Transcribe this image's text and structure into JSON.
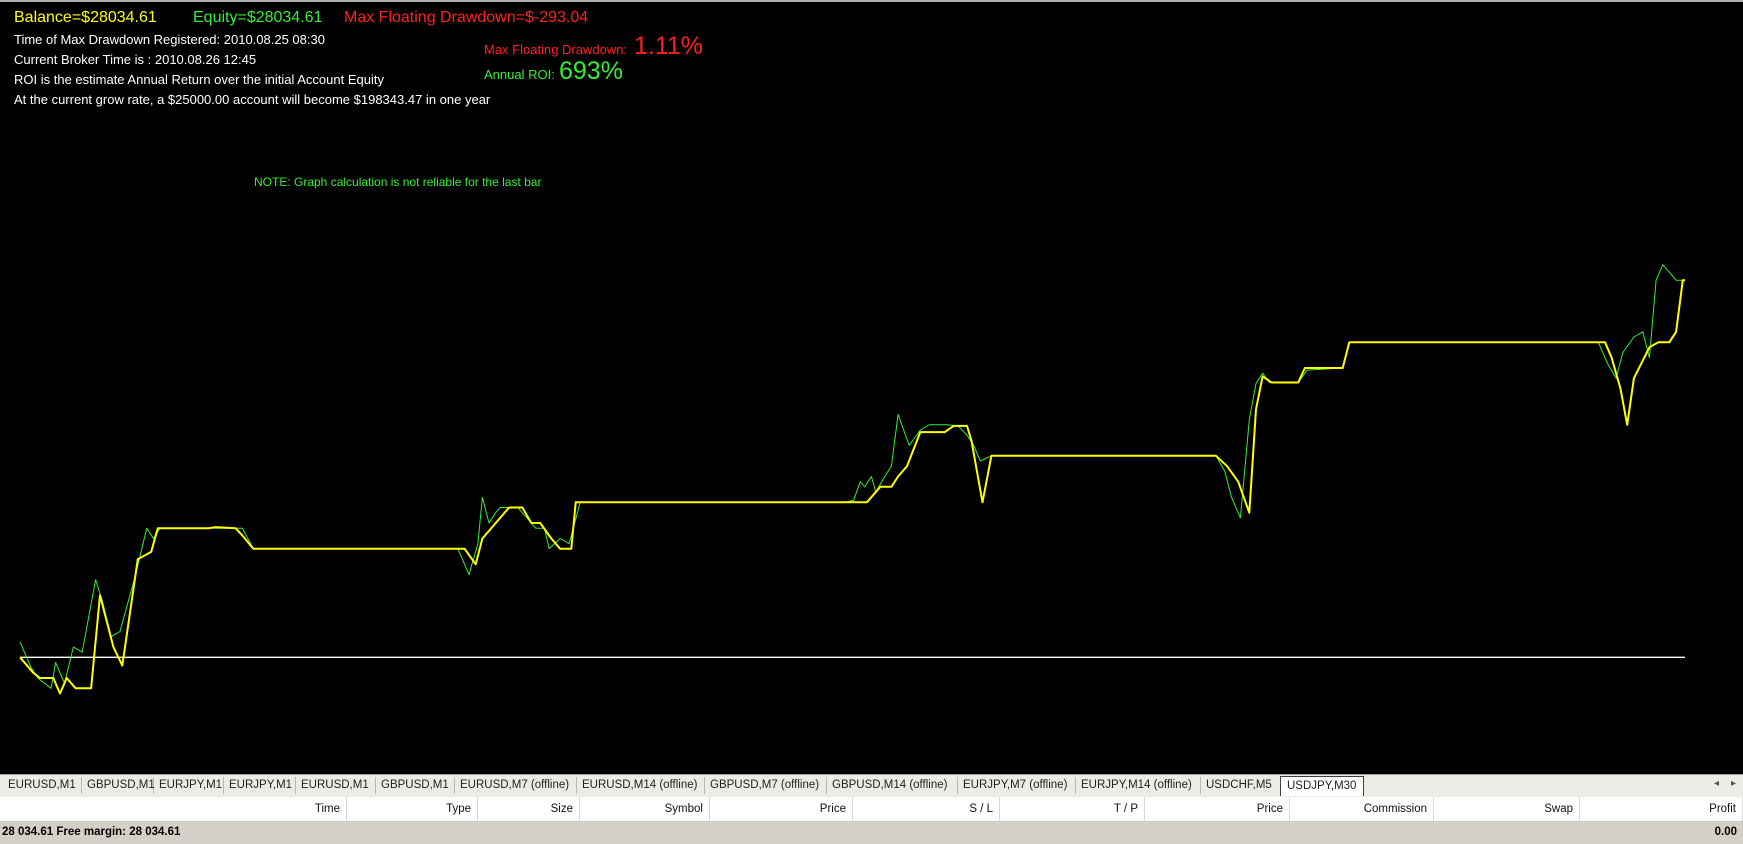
{
  "info": {
    "balance": "Balance=$28034.61",
    "equity": "Equity=$28034.61",
    "max_floating_drawdown": "Max Floating Drawdown=$-293.04",
    "time_max_drawdown": "Time of Max Drawdown Registered: 2010.08.25 08:30",
    "broker_time": "Current Broker Time is : 2010.08.26 12:45",
    "roi_note": "ROI is the estimate Annual Return over the initial Account Equity",
    "grow_rate": "At the current grow rate,  a $25000.00 account will become $198343.47 in one year",
    "dd_pct_label": "Max Floating Drawdown:",
    "dd_pct_value": "1.11%",
    "roi_label": "Annual ROI:",
    "roi_value": "693%",
    "graph_note": "NOTE: Graph calculation is not reliable for the last bar"
  },
  "colors": {
    "background": "#000000",
    "balance_yellow": "#ffff00",
    "equity_green": "#33ee33",
    "drawdown_red": "#ff2020",
    "baseline_white": "#ffffff"
  },
  "chart_data": {
    "type": "line",
    "title": "",
    "xlabel": "",
    "ylabel": "",
    "baseline": 25000,
    "ylim": [
      24200,
      30200
    ],
    "series": [
      {
        "color": "#ffff00",
        "points": [
          [
            0,
            25000
          ],
          [
            12,
            24850
          ],
          [
            18,
            24800
          ],
          [
            30,
            24800
          ],
          [
            36,
            24650
          ],
          [
            42,
            24800
          ],
          [
            50,
            24700
          ],
          [
            64,
            24700
          ],
          [
            72,
            25600
          ],
          [
            84,
            25100
          ],
          [
            92,
            24920
          ],
          [
            106,
            25950
          ],
          [
            118,
            26020
          ],
          [
            124,
            26250
          ],
          [
            170,
            26250
          ],
          [
            176,
            26260
          ],
          [
            194,
            26250
          ],
          [
            200,
            26180
          ],
          [
            210,
            26050
          ],
          [
            400,
            26050
          ],
          [
            410,
            25900
          ],
          [
            416,
            26150
          ],
          [
            440,
            26450
          ],
          [
            452,
            26450
          ],
          [
            460,
            26300
          ],
          [
            468,
            26300
          ],
          [
            478,
            26150
          ],
          [
            486,
            26050
          ],
          [
            496,
            26050
          ],
          [
            500,
            26500
          ],
          [
            762,
            26500
          ],
          [
            774,
            26650
          ],
          [
            784,
            26650
          ],
          [
            790,
            26750
          ],
          [
            798,
            26850
          ],
          [
            810,
            27180
          ],
          [
            832,
            27180
          ],
          [
            840,
            27240
          ],
          [
            852,
            27240
          ],
          [
            856,
            27100
          ],
          [
            866,
            26500
          ],
          [
            874,
            26950
          ],
          [
            1076,
            26950
          ],
          [
            1086,
            26850
          ],
          [
            1096,
            26700
          ],
          [
            1106,
            26400
          ],
          [
            1112,
            27400
          ],
          [
            1118,
            27720
          ],
          [
            1126,
            27660
          ],
          [
            1150,
            27660
          ],
          [
            1156,
            27800
          ],
          [
            1190,
            27800
          ],
          [
            1196,
            28050
          ],
          [
            1426,
            28050
          ],
          [
            1432,
            27900
          ],
          [
            1440,
            27600
          ],
          [
            1446,
            27250
          ],
          [
            1452,
            27700
          ],
          [
            1466,
            28000
          ],
          [
            1474,
            28050
          ],
          [
            1484,
            28050
          ],
          [
            1490,
            28150
          ],
          [
            1496,
            28650
          ],
          [
            1498,
            28650
          ]
        ]
      },
      {
        "color": "#33ee33",
        "points": [
          [
            0,
            25150
          ],
          [
            10,
            24900
          ],
          [
            16,
            24800
          ],
          [
            28,
            24700
          ],
          [
            32,
            24950
          ],
          [
            40,
            24750
          ],
          [
            48,
            25100
          ],
          [
            56,
            25050
          ],
          [
            68,
            25750
          ],
          [
            74,
            25550
          ],
          [
            82,
            25200
          ],
          [
            90,
            25250
          ],
          [
            104,
            25800
          ],
          [
            114,
            26250
          ],
          [
            120,
            26150
          ],
          [
            126,
            26250
          ],
          [
            170,
            26250
          ],
          [
            200,
            26250
          ],
          [
            210,
            26050
          ],
          [
            394,
            26050
          ],
          [
            400,
            25900
          ],
          [
            404,
            25800
          ],
          [
            412,
            26100
          ],
          [
            416,
            26550
          ],
          [
            422,
            26300
          ],
          [
            428,
            26400
          ],
          [
            432,
            26450
          ],
          [
            448,
            26450
          ],
          [
            456,
            26350
          ],
          [
            464,
            26250
          ],
          [
            472,
            26250
          ],
          [
            476,
            26050
          ],
          [
            486,
            26150
          ],
          [
            494,
            26100
          ],
          [
            504,
            26500
          ],
          [
            742,
            26500
          ],
          [
            750,
            26520
          ],
          [
            756,
            26700
          ],
          [
            760,
            26650
          ],
          [
            766,
            26750
          ],
          [
            770,
            26600
          ],
          [
            778,
            26750
          ],
          [
            784,
            26850
          ],
          [
            790,
            27350
          ],
          [
            800,
            27050
          ],
          [
            810,
            27200
          ],
          [
            818,
            27250
          ],
          [
            826,
            27250
          ],
          [
            834,
            27250
          ],
          [
            844,
            27240
          ],
          [
            852,
            27150
          ],
          [
            858,
            27050
          ],
          [
            864,
            26900
          ],
          [
            874,
            26950
          ],
          [
            1076,
            26950
          ],
          [
            1084,
            26800
          ],
          [
            1090,
            26550
          ],
          [
            1098,
            26350
          ],
          [
            1106,
            27300
          ],
          [
            1112,
            27650
          ],
          [
            1118,
            27750
          ],
          [
            1124,
            27660
          ],
          [
            1150,
            27660
          ],
          [
            1158,
            27780
          ],
          [
            1190,
            27800
          ],
          [
            1196,
            28050
          ],
          [
            1420,
            28050
          ],
          [
            1428,
            27850
          ],
          [
            1436,
            27700
          ],
          [
            1442,
            27950
          ],
          [
            1452,
            28100
          ],
          [
            1460,
            28150
          ],
          [
            1466,
            27900
          ],
          [
            1472,
            28650
          ],
          [
            1478,
            28800
          ],
          [
            1490,
            28650
          ],
          [
            1498,
            28650
          ]
        ]
      },
      {
        "color": "#ffffff",
        "points": [
          [
            0,
            25000
          ],
          [
            1498,
            25000
          ]
        ]
      }
    ]
  },
  "tabs": [
    {
      "label": "EURUSD,M1",
      "active": false
    },
    {
      "label": "GBPUSD,M1",
      "active": false
    },
    {
      "label": "EURJPY,M1",
      "active": false
    },
    {
      "label": "EURJPY,M1",
      "active": false
    },
    {
      "label": "EURUSD,M1",
      "active": false
    },
    {
      "label": "GBPUSD,M1",
      "active": false
    },
    {
      "label": "EURUSD,M7 (offline)",
      "active": false
    },
    {
      "label": "EURUSD,M14 (offline)",
      "active": false
    },
    {
      "label": "GBPUSD,M7 (offline)",
      "active": false
    },
    {
      "label": "GBPUSD,M14 (offline)",
      "active": false
    },
    {
      "label": "EURJPY,M7 (offline)",
      "active": false
    },
    {
      "label": "EURJPY,M14 (offline)",
      "active": false
    },
    {
      "label": "USDCHF,M5",
      "active": false
    },
    {
      "label": "USDJPY,M30",
      "active": true
    }
  ],
  "tab_nav": {
    "prev": "◂",
    "next": "▸"
  },
  "trade_columns": [
    "Time",
    "Type",
    "Size",
    "Symbol",
    "Price",
    "S / L",
    "T / P",
    "Price",
    "Commission",
    "Swap",
    "Profit"
  ],
  "balance_row": {
    "text": "28 034.61  Free margin: 28 034.61",
    "profit": "0.00"
  }
}
